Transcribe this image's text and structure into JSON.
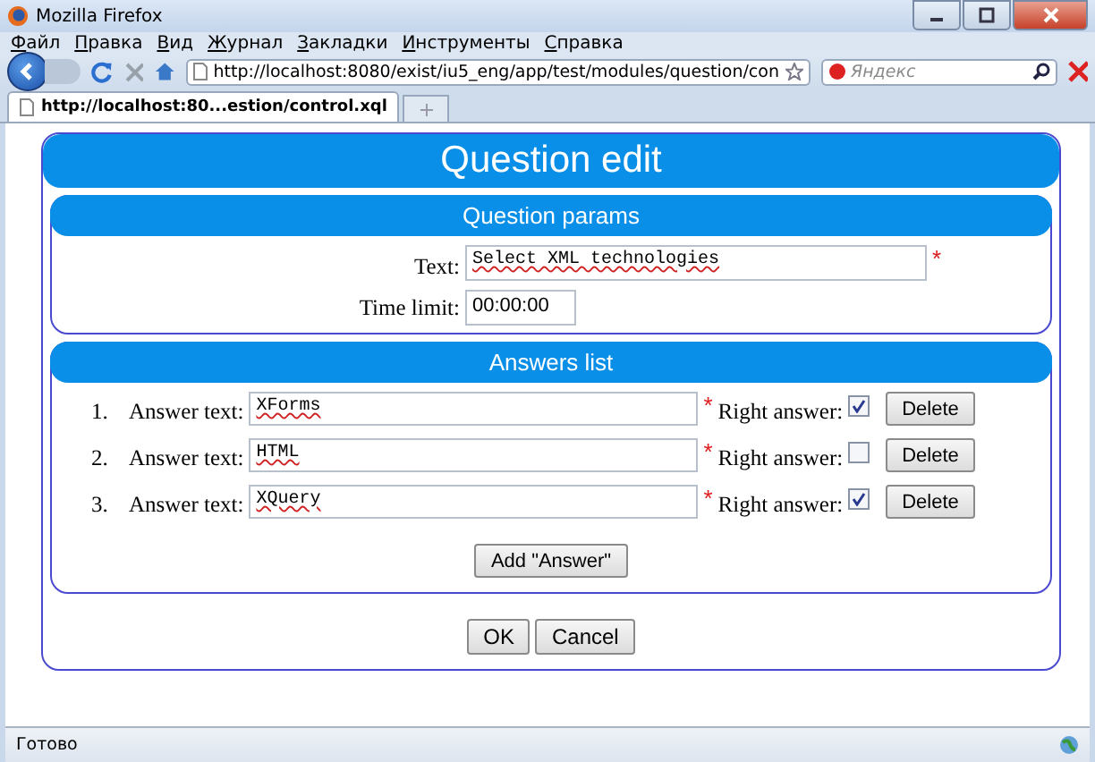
{
  "window": {
    "title": "Mozilla Firefox"
  },
  "menu": [
    "Файл",
    "Правка",
    "Вид",
    "Журнал",
    "Закладки",
    "Инструменты",
    "Справка"
  ],
  "address_bar": {
    "url": "http://localhost:8080/exist/iu5_eng/app/test/modules/question/con"
  },
  "search": {
    "placeholder": "Яндекс"
  },
  "tabs": [
    {
      "label": "http://localhost:80...estion/control.xql",
      "selected": true
    }
  ],
  "page": {
    "title": "Question edit",
    "params": {
      "title": "Question params",
      "text_label": "Text:",
      "text_value": "Select XML technologies",
      "required_mark": "*",
      "time_label": "Time limit:",
      "time_value": "00:00:00"
    },
    "answers": {
      "title": "Answers list",
      "items": [
        {
          "number": "1.",
          "label": "Answer text:",
          "value": "XForms",
          "required_mark": "*",
          "right_label": "Right answer:",
          "checked": true,
          "delete": "Delete"
        },
        {
          "number": "2.",
          "label": "Answer text:",
          "value": "HTML",
          "required_mark": "*",
          "right_label": "Right answer:",
          "checked": false,
          "delete": "Delete"
        },
        {
          "number": "3.",
          "label": "Answer text:",
          "value": "XQuery",
          "required_mark": "*",
          "right_label": "Right answer:",
          "checked": true,
          "delete": "Delete"
        }
      ],
      "add_button": "Add \"Answer\""
    },
    "buttons": [
      "OK",
      "Cancel"
    ]
  },
  "status_bar": "Готово"
}
